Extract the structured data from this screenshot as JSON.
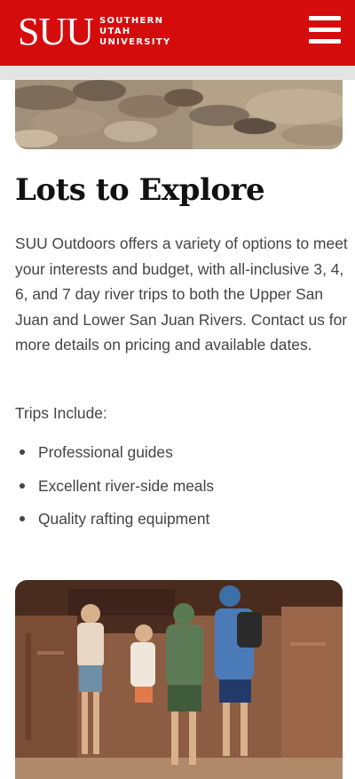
{
  "header": {
    "logo_mark": "SUU",
    "logo_line1": "SOUTHERN",
    "logo_line2": "UTAH",
    "logo_line3": "UNIVERSITY",
    "brand_color": "#d50c0c",
    "menu_icon": "hamburger-menu-icon"
  },
  "main": {
    "heading": "Lots to Explore",
    "paragraph": "SUU Outdoors offers a variety of options to meet your interests and budget, with all-inclusive 3, 4, 6, and 7 day river trips to both the Upper San Juan and Lower San Juan Rivers. Contact us for more details on pricing and available dates.",
    "trips_label": "Trips Include:",
    "trips": [
      "Professional guides",
      "Excellent river-side meals",
      "Quality rafting equipment"
    ]
  }
}
